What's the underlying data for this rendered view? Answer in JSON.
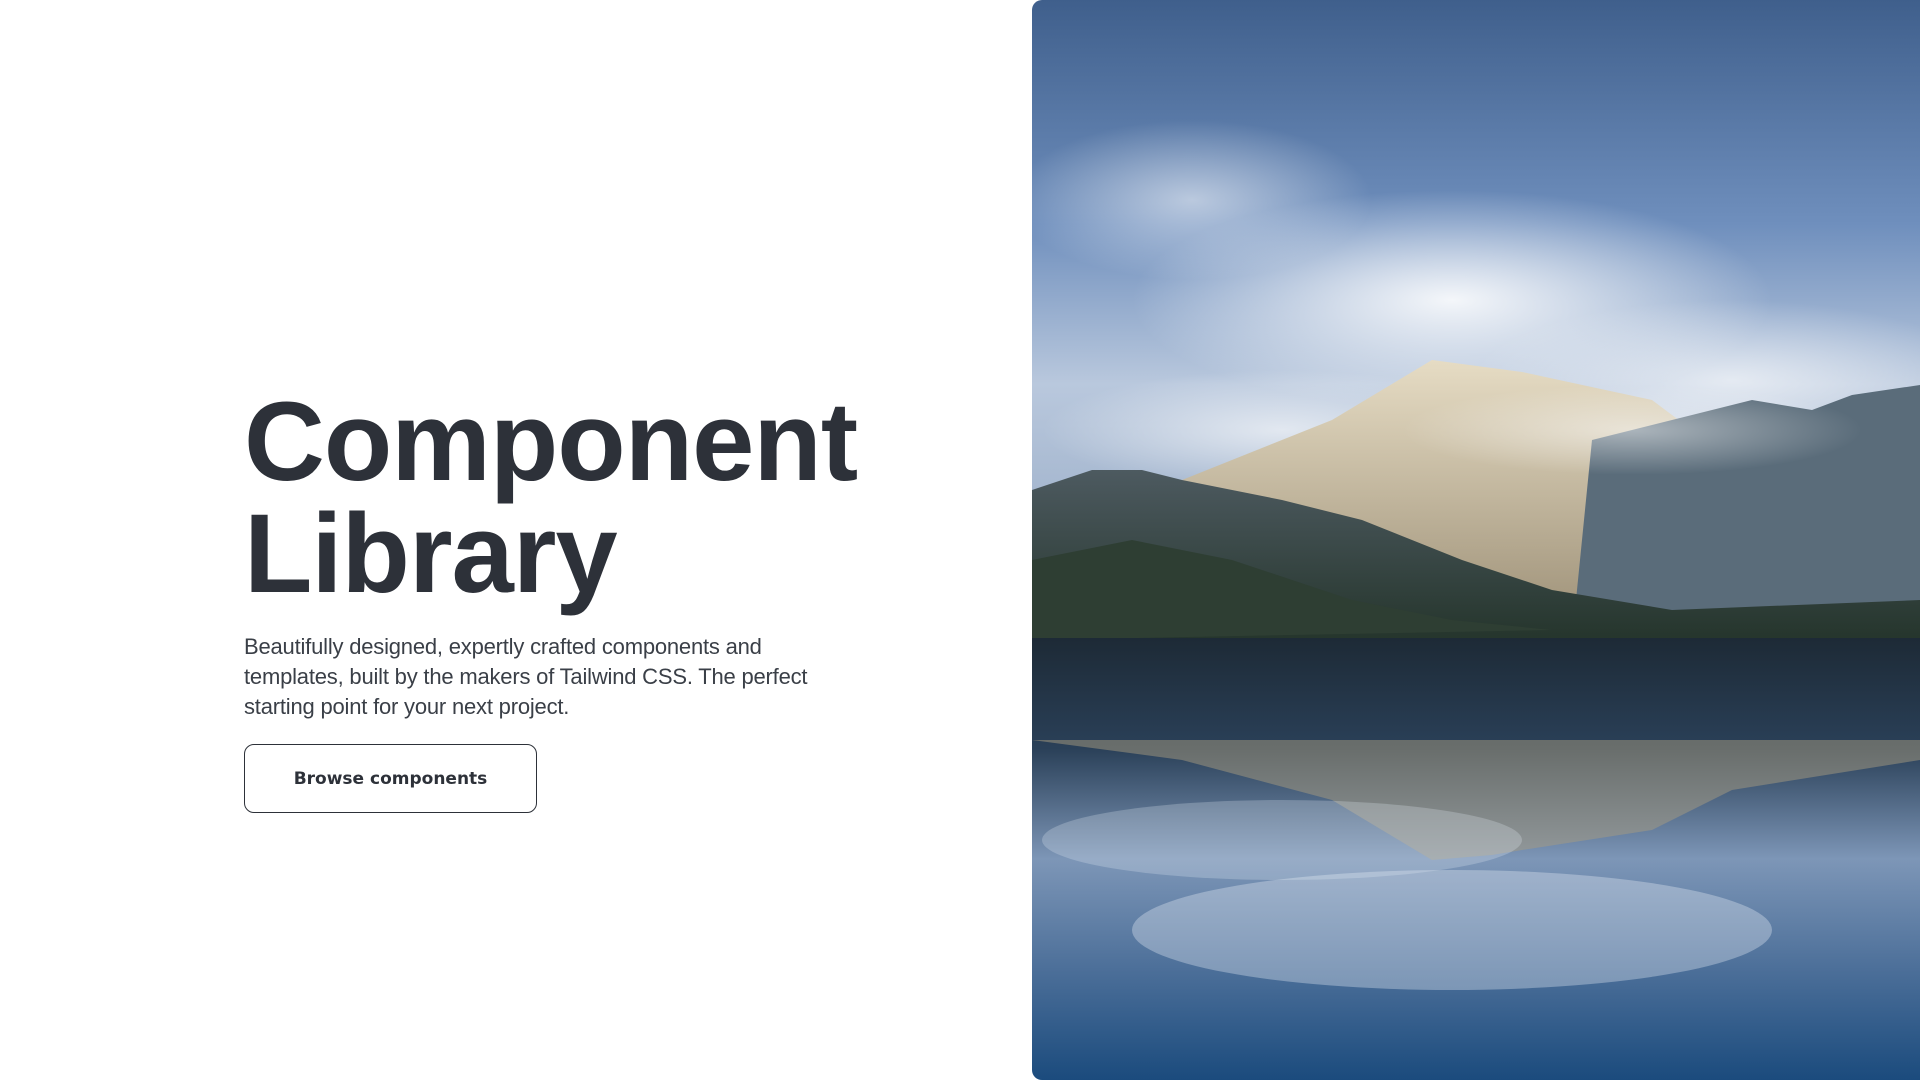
{
  "hero": {
    "title_line1": "Component",
    "title_line2": "Library",
    "description": "Beautifully designed, expertly crafted components and templates, built by the makers of Tailwind CSS. The perfect starting point for your next project.",
    "button_label": "Browse components"
  },
  "image": {
    "subject": "mountain lake reflection under cloudy sky"
  },
  "colors": {
    "text_primary": "#2d3139",
    "background": "#ffffff"
  }
}
